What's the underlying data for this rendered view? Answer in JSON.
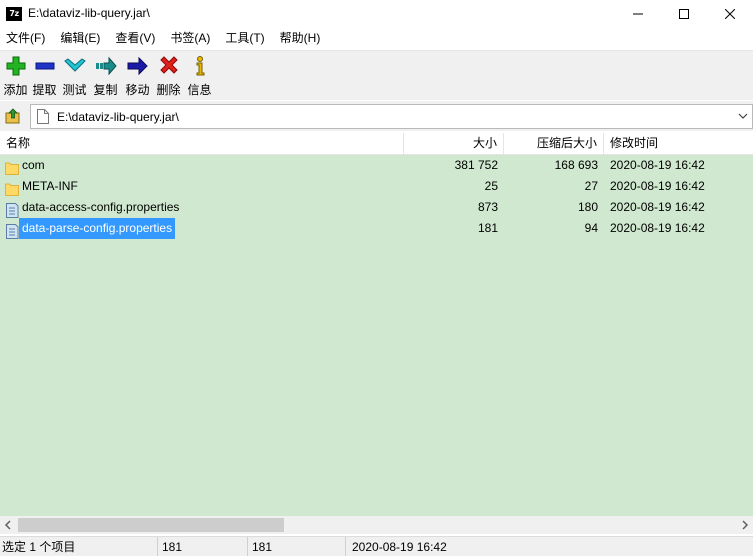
{
  "window": {
    "app_icon_text": "7z",
    "title": "E:\\dataviz-lib-query.jar\\"
  },
  "menu": [
    "文件(F)",
    "编辑(E)",
    "查看(V)",
    "书签(A)",
    "工具(T)",
    "帮助(H)"
  ],
  "toolbar": {
    "add": "添加",
    "extract": "提取",
    "test": "测试",
    "copy": "复制",
    "move": "移动",
    "delete": "删除",
    "info": "信息"
  },
  "address": {
    "value": "E:\\dataviz-lib-query.jar\\"
  },
  "columns": {
    "name": "名称",
    "size": "大小",
    "packed": "压缩后大小",
    "modified": "修改时间"
  },
  "files": [
    {
      "name": "com",
      "type": "folder",
      "size": "381 752",
      "packed": "168 693",
      "modified": "2020-08-19 16:42",
      "selected": false
    },
    {
      "name": "META-INF",
      "type": "folder",
      "size": "25",
      "packed": "27",
      "modified": "2020-08-19 16:42",
      "selected": false
    },
    {
      "name": "data-access-config.properties",
      "type": "file",
      "size": "873",
      "packed": "180",
      "modified": "2020-08-19 16:42",
      "selected": false
    },
    {
      "name": "data-parse-config.properties",
      "type": "file",
      "size": "181",
      "packed": "94",
      "modified": "2020-08-19 16:42",
      "selected": true
    }
  ],
  "status": {
    "selection": "选定 1 个项目",
    "size": "181",
    "packed": "181",
    "modified": "2020-08-19 16:42"
  },
  "colors": {
    "list_background": "#cfe8cf",
    "selection": "#3399ff",
    "folder": "#ffd966"
  }
}
